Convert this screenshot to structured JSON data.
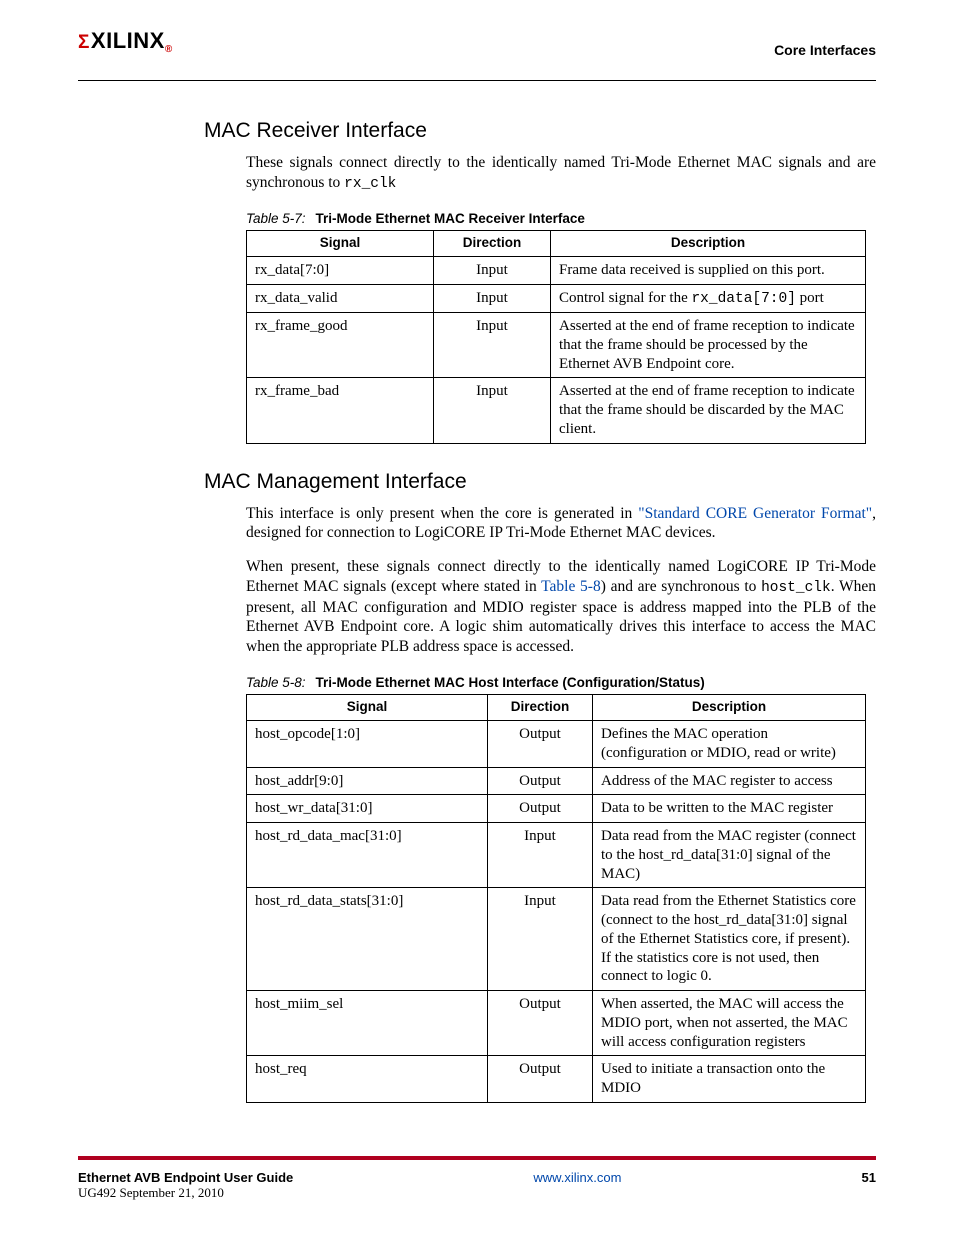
{
  "header": {
    "logo_sigma": "Σ",
    "logo_text": "XILINX",
    "section_label": "Core Interfaces"
  },
  "section1": {
    "title": "MAC Receiver Interface",
    "para_a": "These signals connect directly to the identically named Tri-Mode Ethernet MAC signals and are synchronous to ",
    "para_a_code": "rx_clk"
  },
  "table7": {
    "caption_num": "Table 5-7:",
    "caption_title": "Tri-Mode Ethernet MAC Receiver Interface",
    "head_signal": "Signal",
    "head_direction": "Direction",
    "head_description": "Description",
    "rows": [
      {
        "signal": "rx_data[7:0]",
        "direction": "Input",
        "desc_a": "Frame data received is supplied on this port."
      },
      {
        "signal": "rx_data_valid",
        "direction": "Input",
        "desc_a": "Control signal for the ",
        "desc_code": "rx_data[7:0]",
        "desc_b": " port"
      },
      {
        "signal": "rx_frame_good",
        "direction": "Input",
        "desc_a": "Asserted at the end of frame reception to indicate that the frame should be processed by the Ethernet AVB Endpoint core."
      },
      {
        "signal": "rx_frame_bad",
        "direction": "Input",
        "desc_a": "Asserted at the end of frame reception to indicate that the frame should be discarded by the MAC client."
      }
    ]
  },
  "section2": {
    "title": "MAC Management Interface",
    "p1_a": "This interface is only present when the core is generated in ",
    "p1_link": "\"Standard CORE Generator Format\"",
    "p1_b": ", designed for connection to LogiCORE IP Tri-Mode Ethernet MAC devices.",
    "p2_a": "When present, these signals connect directly to the identically named LogiCORE IP Tri-Mode Ethernet MAC signals (except where stated in ",
    "p2_link": "Table 5-8",
    "p2_b": ") and are synchronous to ",
    "p2_code": "host_clk",
    "p2_c": ". When present, all MAC configuration and MDIO register space is address mapped into the PLB of the Ethernet AVB Endpoint core. A logic shim automatically drives this interface to access the MAC when the appropriate PLB address space is accessed."
  },
  "table8": {
    "caption_num": "Table 5-8:",
    "caption_title": "Tri-Mode Ethernet MAC Host Interface (Configuration/Status)",
    "head_signal": "Signal",
    "head_direction": "Direction",
    "head_description": "Description",
    "rows": [
      {
        "signal": "host_opcode[1:0]",
        "direction": "Output",
        "desc": "Defines the MAC operation (configuration or MDIO, read or write)"
      },
      {
        "signal": "host_addr[9:0]",
        "direction": "Output",
        "desc": "Address of the MAC register to access"
      },
      {
        "signal": "host_wr_data[31:0]",
        "direction": "Output",
        "desc": "Data to be written to the MAC register"
      },
      {
        "signal": "host_rd_data_mac[31:0]",
        "direction": "Input",
        "desc": "Data read from the MAC register (connect to the host_rd_data[31:0] signal of the MAC)"
      },
      {
        "signal": "host_rd_data_stats[31:0]",
        "direction": "Input",
        "desc": "Data read from the Ethernet Statistics core (connect to the host_rd_data[31:0] signal of the Ethernet Statistics core, if present). If the statistics core is not used, then connect to logic 0."
      },
      {
        "signal": "host_miim_sel",
        "direction": "Output",
        "desc": "When asserted, the MAC will access the MDIO port, when not asserted, the MAC will access configuration registers"
      },
      {
        "signal": "host_req",
        "direction": "Output",
        "desc": "Used to initiate a transaction onto the MDIO"
      }
    ]
  },
  "footer": {
    "guide_title": "Ethernet AVB Endpoint User Guide",
    "doc_id": "UG492 September 21, 2010",
    "url_label": "www.xilinx.com",
    "page_number": "51"
  }
}
